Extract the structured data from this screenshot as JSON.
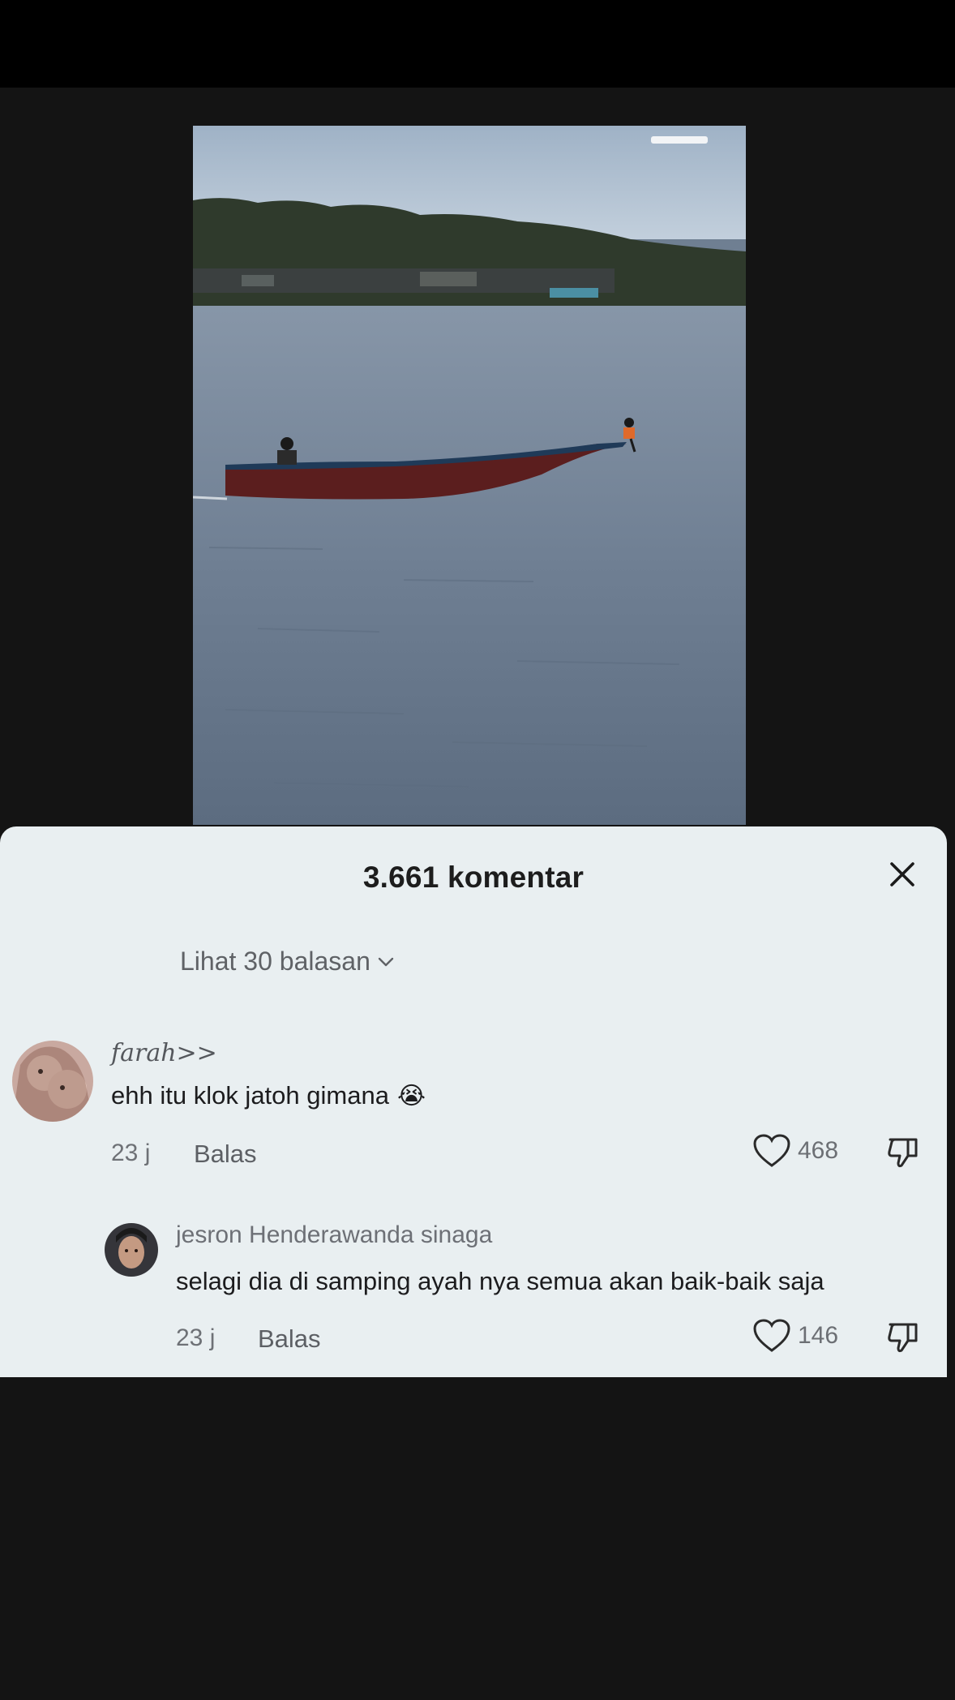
{
  "sheet": {
    "title": "3.661 komentar",
    "view_replies": "Lihat 30 balasan"
  },
  "comments": [
    {
      "username": "farah>>",
      "text": "ehh itu klok jatoh gimana",
      "emoji": "😭",
      "time": "23 j",
      "reply_label": "Balas",
      "likes": "468"
    },
    {
      "username": "jesron Henderawanda sinaga",
      "text": "selagi dia di samping ayah nya semua akan baik-baik saja",
      "time": "23 j",
      "reply_label": "Balas",
      "likes": "146"
    }
  ],
  "icons": {
    "close": "close-icon",
    "chevron": "chevron-down-icon",
    "like": "heart-icon",
    "dislike": "thumbs-down-icon"
  }
}
